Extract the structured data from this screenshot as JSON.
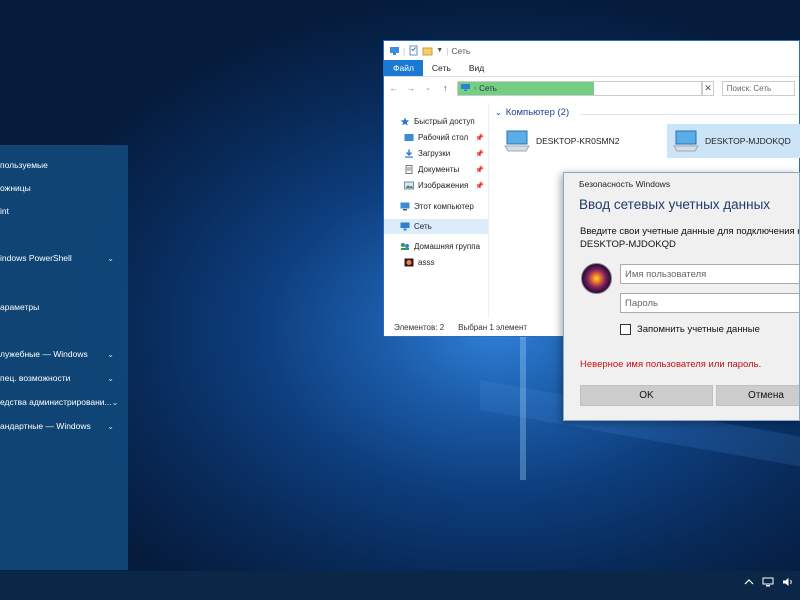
{
  "start_menu": {
    "items": [
      {
        "label": "пользуемые",
        "has_chevron": false
      },
      {
        "label": "ожницы",
        "has_chevron": false
      },
      {
        "label": "int",
        "has_chevron": false
      },
      {
        "label": "indows PowerShell",
        "has_chevron": true
      },
      {
        "label": "араметры",
        "has_chevron": false
      },
      {
        "label": "лужебные — Windows",
        "has_chevron": true
      },
      {
        "label": "пец. возможности",
        "has_chevron": true
      },
      {
        "label": "едства администрировани...",
        "has_chevron": true
      },
      {
        "label": "андартные — Windows",
        "has_chevron": true
      }
    ],
    "chevron": "⌄"
  },
  "explorer": {
    "title": "Сеть",
    "ribbon_tabs": [
      "Файл",
      "Сеть",
      "Вид"
    ],
    "address": {
      "path": "Сеть",
      "progress": 0.56
    },
    "search_placeholder": "Поиск: Сеть",
    "nav": [
      {
        "label": "Быстрый доступ",
        "icon": "star-icon",
        "pinned": false
      },
      {
        "label": "Рабочий стол",
        "icon": "desktop-folder-icon",
        "pinned": true
      },
      {
        "label": "Загрузки",
        "icon": "downloads-icon",
        "pinned": true
      },
      {
        "label": "Документы",
        "icon": "documents-icon",
        "pinned": true
      },
      {
        "label": "Изображения",
        "icon": "pictures-icon",
        "pinned": true
      },
      {
        "label": "Этот компьютер",
        "icon": "computer-icon",
        "pinned": false
      },
      {
        "label": "Сеть",
        "icon": "network-icon",
        "pinned": false,
        "selected": true
      },
      {
        "label": "Домашняя группа",
        "icon": "homegroup-icon",
        "pinned": false
      },
      {
        "label": "asss",
        "icon": "user-icon",
        "pinned": false
      }
    ],
    "group_header": "Компьютер (2)",
    "computers": [
      {
        "name": "DESKTOP-KR0SMN2",
        "selected": false
      },
      {
        "name": "DESKTOP-MJDOKQD",
        "selected": true
      }
    ],
    "status": {
      "count": "Элементов: 2",
      "selected": "Выбран 1 элемент"
    }
  },
  "dialog": {
    "title": "Безопасность Windows",
    "heading": "Ввод сетевых учетных данных",
    "prompt": "Введите свои учетные данные для подключения к:",
    "host": "DESKTOP-MJDOKQD",
    "username_placeholder": "Имя пользователя",
    "password_placeholder": "Пароль",
    "remember_label": "Запомнить учетные данные",
    "error": "Неверное имя пользователя или пароль.",
    "ok_label": "OK",
    "cancel_label": "Отмена"
  },
  "colors": {
    "accent": "#1a79d2",
    "error": "#c41212",
    "address_progress": "#74cf84"
  }
}
